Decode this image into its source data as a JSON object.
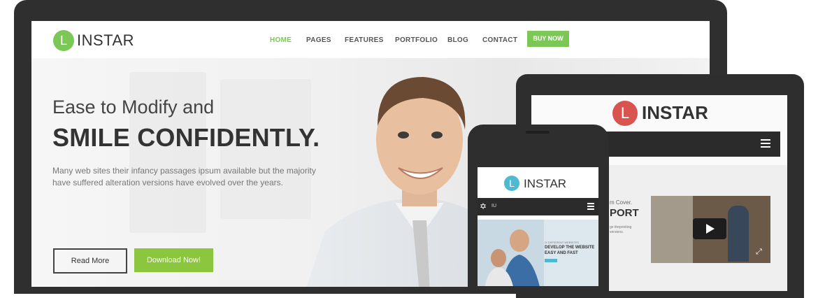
{
  "desktop": {
    "logo": {
      "letter": "L",
      "text": "INSTAR"
    },
    "nav": [
      {
        "label": "HOME",
        "active": true
      },
      {
        "label": "PAGES"
      },
      {
        "label": "FEATURES"
      },
      {
        "label": "PORTFOLIO"
      },
      {
        "label": "BLOG"
      },
      {
        "label": "CONTACT"
      }
    ],
    "buy_label": "BUY NOW",
    "hero": {
      "heading_line1": "Ease to Modify and",
      "heading_line2": "SMILE CONFIDENTLY.",
      "paragraph": "Many web sites their infancy passages ipsum available but the majority have suffered alteration versions have evolved over the years.",
      "read_more": "Read More",
      "download": "Download Now!"
    }
  },
  "tablet": {
    "logo": {
      "letter": "L",
      "text": "INSTAR"
    },
    "hero_small": "m Cover.",
    "hero_title": "PORT",
    "hero_text": "ge thepriniting versions."
  },
  "phone": {
    "logo": {
      "letter": "L",
      "text": "INSTAR"
    },
    "nav_text": "IU",
    "hero_small": "IX DIFFERENT WEBSITES",
    "hero_title": "DEVELOP THE WEBSITE EASY AND FAST"
  },
  "colors": {
    "accent": "#7cc856",
    "download_button": "#8cc63f",
    "tablet_logo": "#d9534f",
    "phone_logo": "#4fb8d3",
    "device_frame": "#2f2f2f"
  }
}
